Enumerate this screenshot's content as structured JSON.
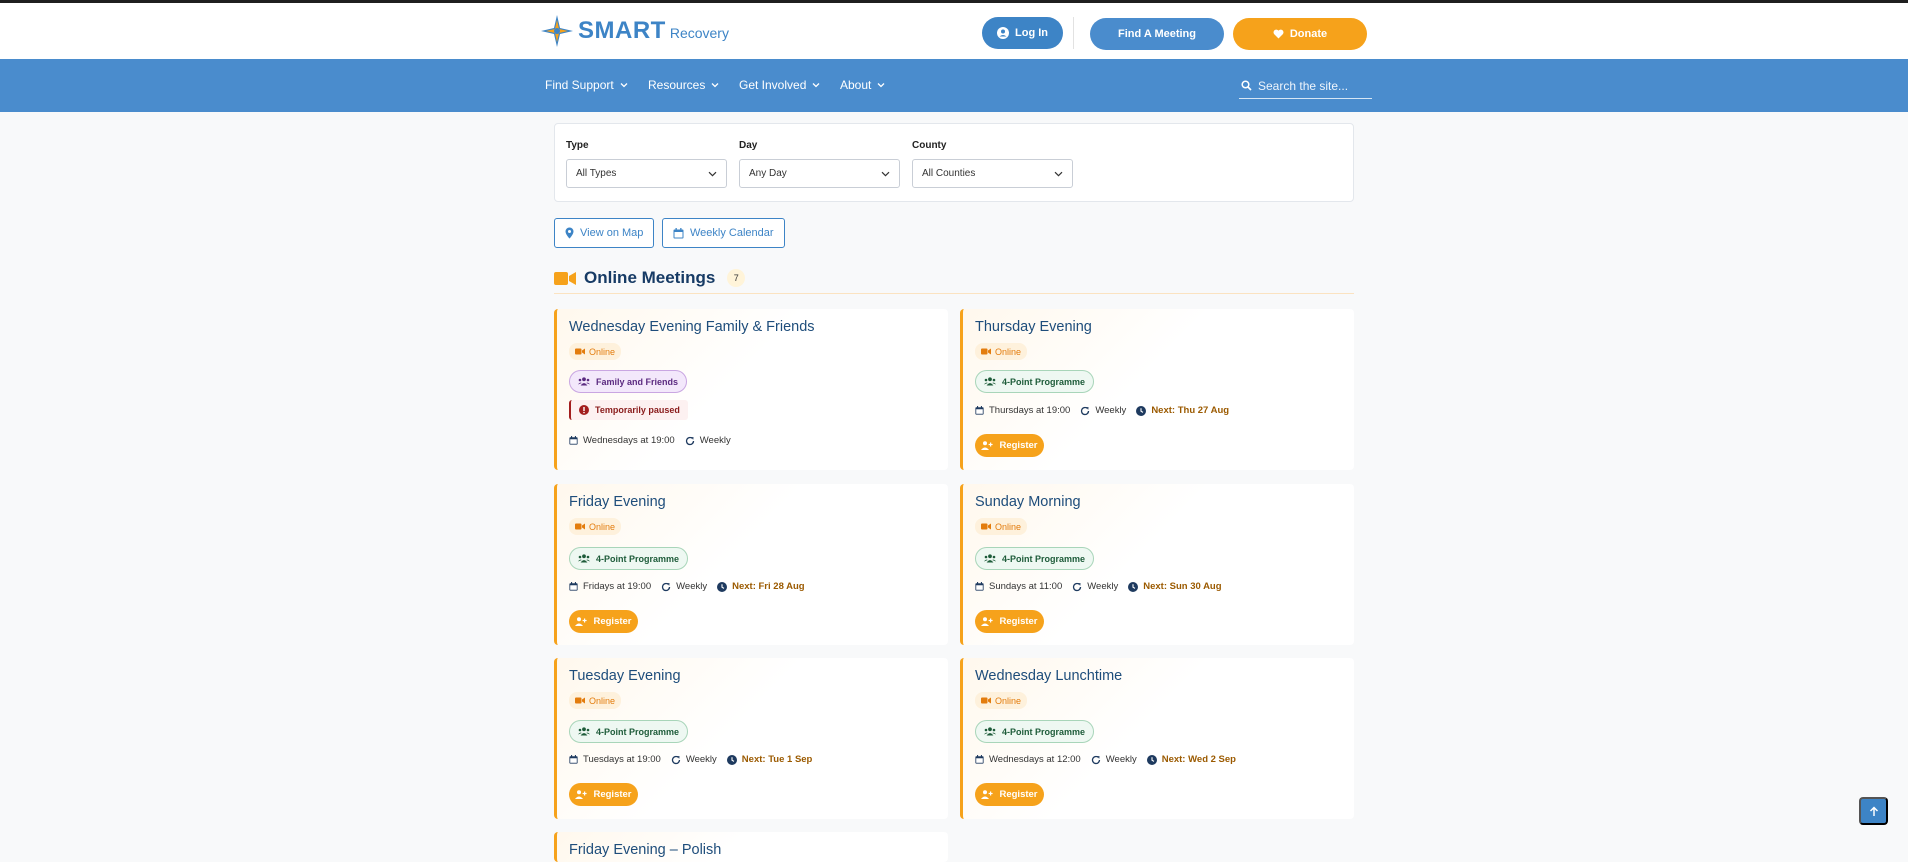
{
  "header": {
    "logo_text": "SMART",
    "logo_sub": "Recovery",
    "login_label": "Log In",
    "find_meeting_label": "Find A Meeting",
    "donate_label": "Donate"
  },
  "nav": {
    "items": [
      {
        "label": "Find Support"
      },
      {
        "label": "Resources"
      },
      {
        "label": "Get Involved"
      },
      {
        "label": "About"
      }
    ],
    "search_placeholder": "Search the site..."
  },
  "filters": {
    "type": {
      "label": "Type",
      "value": "All Types"
    },
    "day": {
      "label": "Day",
      "value": "Any Day"
    },
    "county": {
      "label": "County",
      "value": "All Counties"
    }
  },
  "actions": {
    "map_label": "View on Map",
    "calendar_label": "Weekly Calendar"
  },
  "section": {
    "title": "Online Meetings",
    "count": "7"
  },
  "meetings": [
    {
      "title": "Wednesday Evening Family & Friends",
      "online": "Online",
      "programme": "Family and Friends",
      "paused": "Temporarily paused",
      "schedule": "Wednesdays at 19:00",
      "frequency": "Weekly"
    },
    {
      "title": "Thursday Evening",
      "online": "Online",
      "programme": "4-Point Programme",
      "schedule": "Thursdays at 19:00",
      "frequency": "Weekly",
      "next": "Next: Thu 27 Aug",
      "register": "Register"
    },
    {
      "title": "Friday Evening",
      "online": "Online",
      "programme": "4-Point Programme",
      "schedule": "Fridays at 19:00",
      "frequency": "Weekly",
      "next": "Next: Fri 28 Aug",
      "register": "Register"
    },
    {
      "title": "Sunday Morning",
      "online": "Online",
      "programme": "4-Point Programme",
      "schedule": "Sundays at 11:00",
      "frequency": "Weekly",
      "next": "Next: Sun 30 Aug",
      "register": "Register"
    },
    {
      "title": "Tuesday Evening",
      "online": "Online",
      "programme": "4-Point Programme",
      "schedule": "Tuesdays at 19:00",
      "frequency": "Weekly",
      "next": "Next: Tue 1 Sep",
      "register": "Register"
    },
    {
      "title": "Wednesday Lunchtime",
      "online": "Online",
      "programme": "4-Point Programme",
      "schedule": "Wednesdays at 12:00",
      "frequency": "Weekly",
      "next": "Next: Wed 2 Sep",
      "register": "Register"
    },
    {
      "title": "Friday Evening – Polish"
    }
  ],
  "colors": {
    "brand_blue": "#4a8ccd",
    "accent_orange": "#f6a21b",
    "title_navy": "#173b65"
  }
}
